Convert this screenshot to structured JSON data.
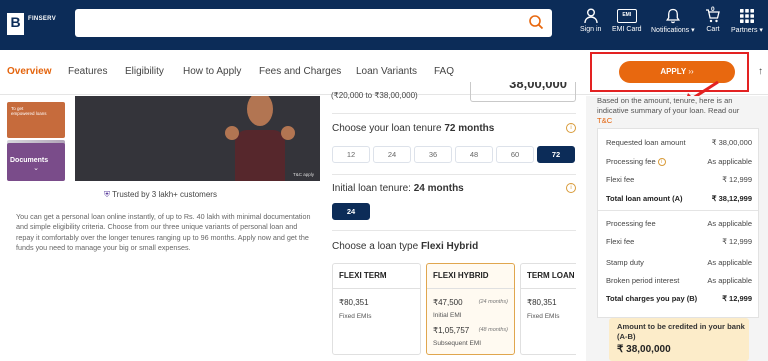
{
  "header": {
    "logo_letter": "B",
    "logo_text": "FINSERV",
    "search_placeholder": "",
    "nav": [
      {
        "label": "Sign in",
        "icon": "user-icon"
      },
      {
        "label": "EMI Card",
        "icon": "card-icon",
        "card_text": "EMI"
      },
      {
        "label": "Notifications ▾",
        "icon": "bell-icon"
      },
      {
        "label": "Cart",
        "icon": "cart-icon",
        "badge": "0"
      },
      {
        "label": "Partners ▾",
        "icon": "grid-icon"
      }
    ]
  },
  "tabs": [
    "Overview",
    "Features",
    "Eligibility",
    "How to Apply",
    "Fees and Charges",
    "Loan Variants",
    "FAQ"
  ],
  "apply_button": "APPLY",
  "thumbnails": [
    {
      "line1": "To get",
      "line2": "empowered loans"
    },
    {
      "line1": "",
      "line2": ""
    },
    {
      "line1": "Documents",
      "line2": ""
    }
  ],
  "hero_tag": "T&C apply",
  "trust_text": "Trusted by 3 lakh+ customers",
  "description": "You can get a personal loan online instantly, of up to Rs. 40 lakh with minimal documentation and simple eligibility criteria. Choose from our three unique variants of personal loan and repay it comfortably over the longer tenures ranging up to 96 months. Apply now and get the funds you need to manage your big or small expenses.",
  "loan": {
    "range": "(₹20,000 to ₹38,00,000)",
    "amount_value": "38,00,000",
    "tenure_label": "Choose your loan tenure",
    "tenure_value": "72 months",
    "tenures": [
      "12",
      "24",
      "36",
      "48",
      "60",
      "72"
    ],
    "selected_tenure": "72",
    "initial_label": "Initial loan tenure:",
    "initial_value": "24 months",
    "initial_button": "24",
    "type_label": "Choose a loan type",
    "type_value": "Flexi Hybrid",
    "cards": [
      {
        "title": "FLEXI TERM",
        "amount": "₹80,351",
        "sub": "Fixed EMIs"
      },
      {
        "title": "FLEXI HYBRID",
        "amount": "₹47,500",
        "months1": "(24 months)",
        "sub": "Initial EMI",
        "amount2": "₹1,05,757",
        "months2": "(48 months)",
        "sub2": "Subsequent EMI"
      },
      {
        "title": "TERM LOAN",
        "amount": "₹80,351",
        "sub": "Fixed EMIs"
      }
    ]
  },
  "summary": {
    "intro_a": "Based on the amount, tenure, here is an",
    "intro_b": "indicative summary of your loan. Read our",
    "tc_link": "T&C",
    "rows": [
      {
        "label": "Requested loan amount",
        "value": "₹ 38,00,000"
      },
      {
        "label": "Processing fee",
        "value": "As applicable"
      },
      {
        "label": "Flexi fee",
        "value": "₹ 12,999"
      },
      {
        "label": "Total loan amount (A)",
        "value": "₹ 38,12,999"
      },
      {
        "label": "Processing fee",
        "value": "As applicable"
      },
      {
        "label": "Flexi fee",
        "value": "₹ 12,999"
      },
      {
        "label": "Stamp duty",
        "value": "As applicable"
      },
      {
        "label": "Broken period interest",
        "value": "As applicable"
      },
      {
        "label": "Total charges you pay (B)",
        "value": "₹ 12,999"
      }
    ],
    "credit_label": "Amount to be credited in your bank (A-B)",
    "credit_value": "₹ 38,00,000"
  },
  "colors": {
    "navy": "#0c2c58",
    "orange": "#e8680f",
    "highlight_red": "#e32222",
    "cream": "#fcecc9"
  }
}
